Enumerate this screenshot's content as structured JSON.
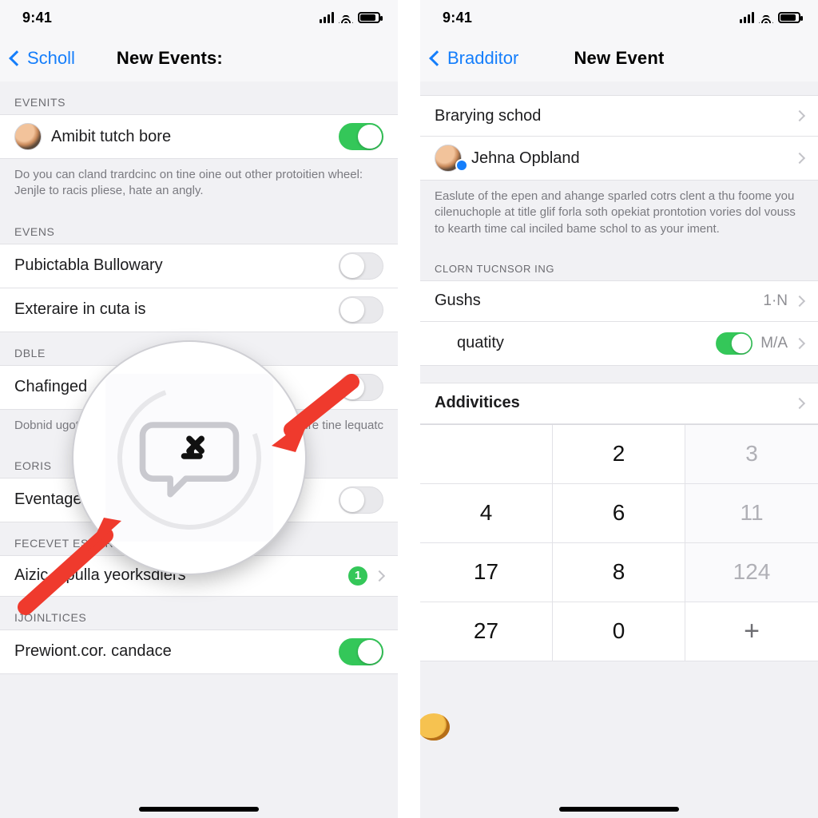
{
  "status": {
    "time": "9:41"
  },
  "left": {
    "back": "Scholl",
    "title": "New Events:",
    "sections": {
      "s1": {
        "header": "EVENITS",
        "row1_label": "Amibit tutch bore",
        "row1_on": true,
        "note": "Do you can cland trardcinc on tine oine out other protoitien wheel: Jenjle to racis pliese, hate an angly."
      },
      "s2": {
        "header": "EVENS",
        "row1_label": "Pubictabla Bullowary",
        "row1_on": false,
        "row2_label": "Exteraire in cuta is",
        "row2_on": false
      },
      "s3": {
        "header": "DBLE",
        "row1_label": "Chafinged",
        "row1_on": false,
        "note_a": "Dobnid ugot",
        "note_b": "pire tine lequatc"
      },
      "s4": {
        "header": "EORIS",
        "row1_label": "Eventage is 0.",
        "row1_on": false
      },
      "s5": {
        "header": "FECEVET ESCARS",
        "row1_label": "Aizic a pulla yeorksdlers",
        "row1_badge": "1"
      },
      "s6": {
        "header": "IJOINLTICES",
        "row1_label": "Prewiont.cor. candace",
        "row1_on": true
      }
    }
  },
  "right": {
    "back": "Bradditor",
    "title": "New Event",
    "top": {
      "row1_label": "Brarying schod",
      "row2_label": "Jehna Opbland",
      "note": "Easlute of the epen and ahange sparled cotrs clent a thu foome you cilenuchople at title glif forla soth opekiat prontotion vories dol vouss to kearth time cal inciled bame schol to as your iment."
    },
    "s1": {
      "header": "CLORN TUCNSOR ING",
      "row1_label": "Gushs",
      "row1_value": "1·N",
      "row2_label": "quatity",
      "row2_on": true,
      "row2_value": "M/A"
    },
    "s2": {
      "row1_label": "Addivitices"
    },
    "keypad": {
      "r1c1": "",
      "r1c2": "2",
      "r1c3": "3",
      "r2c1": "4",
      "r2c2": "6",
      "r2c3": "11",
      "r3c1": "17",
      "r3c2": "8",
      "r3c3": "124",
      "r4c1": "27",
      "r4c2": "0",
      "r4c3": "+"
    }
  }
}
